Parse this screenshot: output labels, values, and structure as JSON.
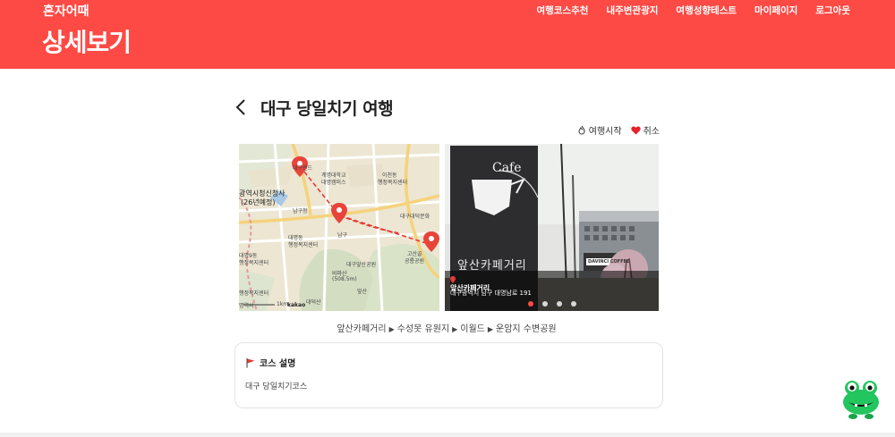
{
  "header": {
    "logo": "혼자어때",
    "page_title": "상세보기",
    "nav": [
      "여행코스추천",
      "내주변관광지",
      "여행성향테스트",
      "마이페이지",
      "로그아웃"
    ]
  },
  "course": {
    "title": "대구 당일치기 여행",
    "actions": {
      "start": "여행시작",
      "cancel": "취소"
    }
  },
  "map": {
    "labels": [
      "대구랜드",
      "계명대학교",
      "대명캠퍼스",
      "이천동",
      "행정복지센터",
      "광역시청신청사",
      "(26년예정)",
      "남구청",
      "대명동",
      "행정복지센터",
      "남구",
      "대구대덕문화",
      "고산골",
      "공룡공원",
      "대구앞산공원",
      "비파산",
      "(508.5m)",
      "앞산",
      "대덕산",
      "행정복지센터",
      "대명9동",
      "행정복지센터",
      "명역사"
    ],
    "scale": "1km",
    "brand": "kakao"
  },
  "photo": {
    "sign_text": "Cafe",
    "signboard_text": "앞산카페거리",
    "shop_sign": "DAVINCI COFFEE",
    "place_name": "앞산카페거리",
    "address": "대구광역시 남구 대명남로 191",
    "slides": 4,
    "active_slide": 1
  },
  "route": [
    "앞산카페거리",
    "수성못 유원지",
    "이월드",
    "운암지 수변공원"
  ],
  "description": {
    "heading": "코스 설명",
    "body": "대구 당일치기코스"
  },
  "colors": {
    "accent": "#fe4a45",
    "mascot": "#22c55e"
  }
}
